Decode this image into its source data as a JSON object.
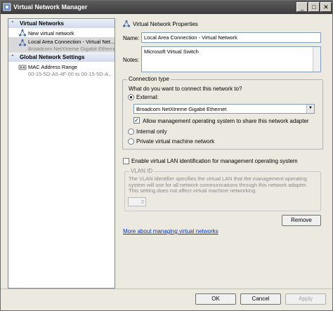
{
  "window": {
    "title": "Virtual Network Manager",
    "min_label": "_",
    "max_label": "□",
    "close_label": "✕"
  },
  "tree": {
    "virtual_networks_header": "Virtual Networks",
    "new_network": "New virtual network",
    "selected_item": {
      "name": "Local Area Connection - Virtual Net...",
      "sub": "Broadcom NetXtreme Gigabit Ethernet..."
    },
    "global_settings_header": "Global Network Settings",
    "mac_range": {
      "name": "MAC Address Range",
      "sub": "00-15-5D-A5-4F-00 to 00-15-5D-A..."
    },
    "chevron": "⌃"
  },
  "properties": {
    "section_title": "Virtual Network Properties",
    "name_label": "Name:",
    "name_value": "Local Area Connection - Virtual Network",
    "notes_label": "Notes:",
    "notes_value": "Microsoft Virtual Switch"
  },
  "connection": {
    "group_title": "Connection type",
    "question": "What do you want to connect this network to?",
    "external_label": "External:",
    "adapter_value": "Broadcom NetXtreme Gigabit Ethernet",
    "allow_mgmt_label": "Allow management operating system to share this network adapter",
    "allow_mgmt_checkmark": "✓",
    "internal_label": "Internal only",
    "private_label": "Private virtual machine network",
    "dropdown_arrow": "▼"
  },
  "vlan": {
    "enable_label": "Enable virtual LAN identification for management operating system",
    "group_title": "VLAN ID",
    "description": "The VLAN identifier specifies the virtual LAN that the management operating system will use for all network communications through this network adapter. This setting does not affect virtual machine networking.",
    "vlan_value": "2"
  },
  "actions": {
    "remove_label": "Remove",
    "more_link": "More about managing virtual networks",
    "ok_label": "OK",
    "cancel_label": "Cancel",
    "apply_label": "Apply"
  }
}
